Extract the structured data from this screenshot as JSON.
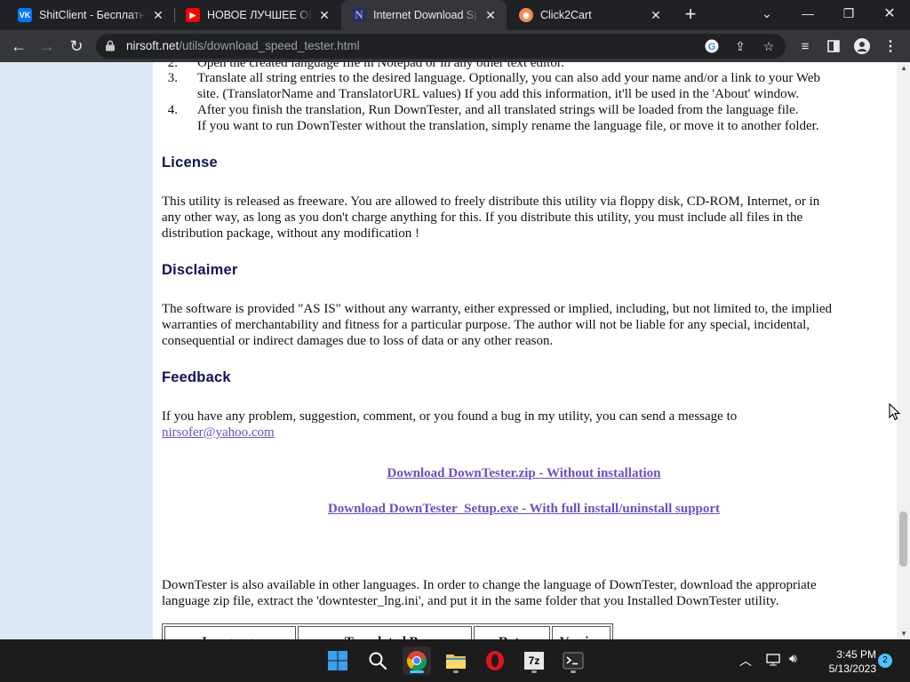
{
  "tabs": [
    {
      "title": "ShitClient - Бесплатный",
      "icon": "vk-icon",
      "color": "#0077ff",
      "active": false
    },
    {
      "title": "НОВОЕ ЛУЧШЕЕ ОБНОВ",
      "icon": "youtube-icon",
      "color": "#ff0000",
      "active": false
    },
    {
      "title": "Internet Download Spe",
      "icon": "nirsoft-icon",
      "color": "#5a6fd6",
      "active": true
    },
    {
      "title": "Click2Cart",
      "icon": "click2cart-icon",
      "color": "#f28b50",
      "active": false
    }
  ],
  "address": {
    "host": "nirsoft.net",
    "path": "/utils/download_speed_tester.html"
  },
  "page": {
    "list_items": [
      {
        "num": "2.",
        "text": "Open the created language file in Notepad or in any other text editor."
      },
      {
        "num": "3.",
        "line1": "Translate all string entries to the desired language. Optionally, you can also add your name and/or a link to your Web",
        "line2": "site. (TranslatorName and TranslatorURL values) If you add this information, it'll be used in the 'About' window."
      },
      {
        "num": "4.",
        "line1": "After you finish the translation, Run DownTester, and all translated strings will be loaded from the language file.",
        "line2": "If you want to run DownTester without the translation, simply rename the language file, or move it to another folder."
      }
    ],
    "license_heading": "License",
    "license_lines": [
      "This utility is released as freeware. You are allowed to freely distribute this utility via floppy disk, CD-ROM, Internet, or in",
      "any other way, as long as you don't charge anything for this. If you distribute this utility, you must include all files in the",
      "distribution package, without any modification !"
    ],
    "disclaimer_heading": "Disclaimer",
    "disclaimer_lines": [
      "The software is provided \"AS IS\" without any warranty, either expressed or implied, including, but not limited to, the implied",
      "warranties of merchantability and fitness for a particular purpose. The author will not be liable for any special, incidental,",
      "consequential or indirect damages due to loss of data or any other reason."
    ],
    "feedback_heading": "Feedback",
    "feedback_text": "If you have any problem, suggestion, comment, or you found a bug in my utility, you can send a message to",
    "feedback_email": "nirsofer@yahoo.com",
    "download_zip": "Download DownTester.zip - Without installation",
    "download_setup": "Download DownTester_Setup.exe - With full install/uninstall support",
    "languages_lines": [
      "DownTester is also available in other languages. In order to change the language of DownTester, download the appropriate",
      "language zip file, extract the 'downtester_lng.ini', and put it in the same folder that you Installed DownTester utility."
    ],
    "table_headers": [
      "Language",
      "Translated By",
      "Date",
      "Version"
    ]
  },
  "taskbar": {
    "time": "3:45 PM",
    "date": "5/13/2023",
    "notifications": "2",
    "seven_zip_label": "7z"
  },
  "colors": {
    "left_panel": "#dde9f7",
    "heading": "#12125a",
    "link": "#6a4fc5",
    "accent": "#4cc2ff"
  }
}
